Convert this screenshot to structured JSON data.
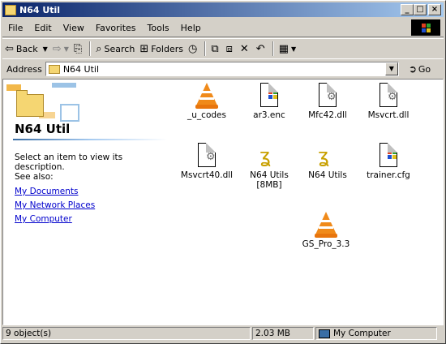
{
  "window": {
    "title": "N64 Util",
    "minimize": "_",
    "maximize": "□",
    "close": "×"
  },
  "menu": [
    "File",
    "Edit",
    "View",
    "Favorites",
    "Tools",
    "Help"
  ],
  "toolbar": {
    "back": "Back",
    "search": "Search",
    "folders": "Folders"
  },
  "address": {
    "label": "Address",
    "value": "N64 Util",
    "go": "Go"
  },
  "panel": {
    "title": "N64 Util",
    "description": "Select an item to view its description.",
    "see_also": "See also:",
    "links": [
      "My Documents",
      "My Network Places",
      "My Computer"
    ]
  },
  "files": [
    {
      "name": "_u_codes",
      "icon": "vlc-cone-icon"
    },
    {
      "name": "ar3.enc",
      "icon": "windows-file-icon"
    },
    {
      "name": "Mfc42.dll",
      "icon": "dll-gear-icon"
    },
    {
      "name": "Msvcrt.dll",
      "icon": "dll-gear-icon"
    },
    {
      "name": "Msvcrt40.dll",
      "icon": "dll-gear-icon"
    },
    {
      "name": "N64 Utils [8MB]",
      "icon": "app-snake-icon"
    },
    {
      "name": "N64 Utils",
      "icon": "app-snake-icon"
    },
    {
      "name": "trainer.cfg",
      "icon": "windows-file-icon"
    },
    {
      "name": "GS_Pro_3.3",
      "icon": "vlc-cone-icon"
    }
  ],
  "status": {
    "objects": "9 object(s)",
    "size": "2.03 MB",
    "zone": "My Computer"
  },
  "colors": {
    "titlebar_start": "#0a246a",
    "titlebar_end": "#a6caf0",
    "link": "#0000cc",
    "face": "#d4d0c8"
  }
}
